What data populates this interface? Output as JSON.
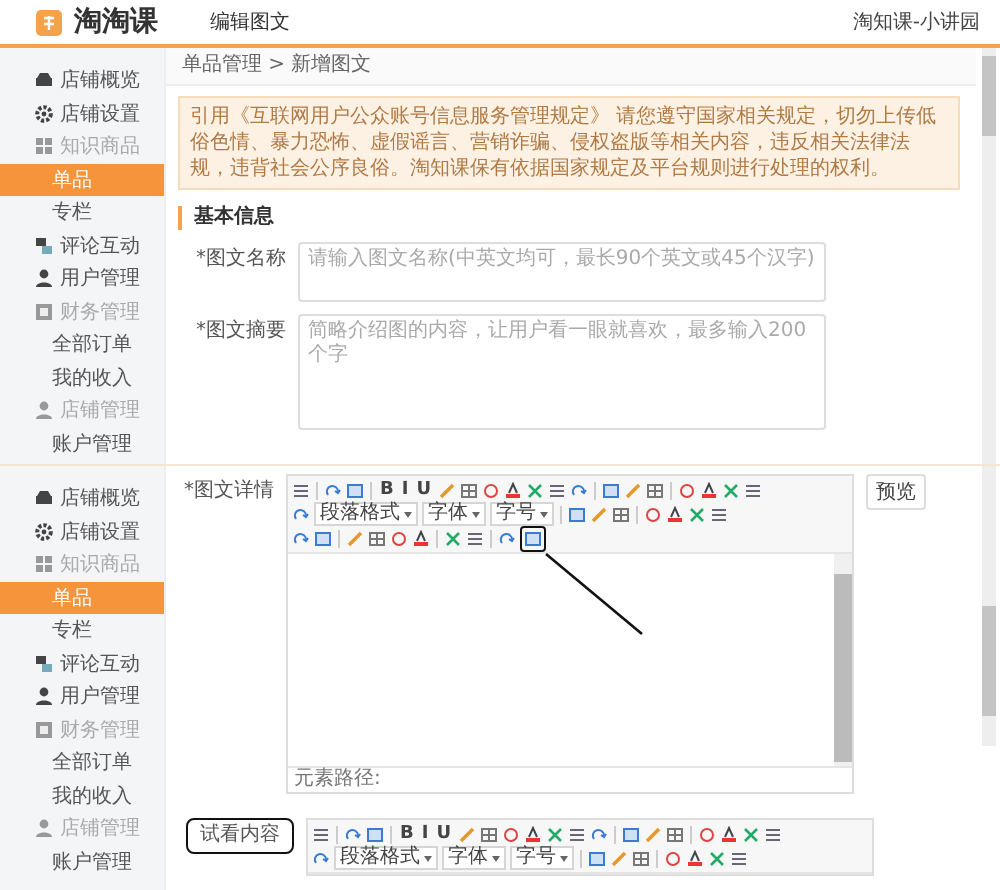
{
  "screens": [
    {
      "kind": "form_top",
      "header": {
        "logo": "淘淘课",
        "tab": "编辑图文",
        "account": "淘知课-小讲园"
      },
      "sidebar": {
        "items": [
          {
            "label": "店铺概览",
            "selected": false
          },
          {
            "label": "店铺设置",
            "selected": false
          },
          {
            "label": "知识商品",
            "selected": false,
            "expanded": true,
            "children": [
              {
                "label": "单品",
                "selected": true
              },
              {
                "label": "专栏",
                "selected": false
              }
            ]
          },
          {
            "label": "评论互动",
            "selected": false
          },
          {
            "label": "用户管理",
            "selected": false
          },
          {
            "label": "财务管理",
            "selected": false,
            "expanded": true,
            "children": [
              {
                "label": "全部订单",
                "selected": false
              },
              {
                "label": "我的收入",
                "selected": false
              }
            ]
          },
          {
            "label": "店铺管理",
            "selected": false,
            "expanded": true,
            "children": [
              {
                "label": "账户管理",
                "selected": false
              }
            ]
          }
        ]
      },
      "breadcrumb": "单品管理 > 新增图文",
      "notice": "引用《互联网用户公众账号信息服务管理规定》 请您遵守国家相关规定，切勿上传低俗色情、暴力恐怖、虚假谣言、营销诈骗、侵权盗版等相关内容，违反相关法律法规，违背社会公序良俗。淘知课保有依据国家规定及平台规则进行处理的权利。",
      "section_title": "基本信息",
      "fields": [
        {
          "label": "*图文名称",
          "kind": "input",
          "placeholder": "请输入图文名称(中英文均可，最长90个英文或45个汉字)"
        },
        {
          "label": "*图文摘要",
          "kind": "textarea",
          "placeholder": "简略介绍图的内容，让用户看一眼就喜欢，最多输入200个字"
        }
      ]
    },
    {
      "kind": "form_bottom",
      "sidebar": {
        "items": [
          {
            "label": "店铺概览",
            "selected": false
          },
          {
            "label": "店铺设置",
            "selected": false
          },
          {
            "label": "知识商品",
            "selected": false,
            "expanded": true,
            "children": [
              {
                "label": "单品",
                "selected": true
              },
              {
                "label": "专栏",
                "selected": false
              }
            ]
          },
          {
            "label": "评论互动",
            "selected": false
          },
          {
            "label": "用户管理",
            "selected": false
          },
          {
            "label": "财务管理",
            "selected": false,
            "expanded": true,
            "children": [
              {
                "label": "全部订单",
                "selected": false
              },
              {
                "label": "我的收入",
                "selected": false
              }
            ]
          },
          {
            "label": "店铺管理",
            "selected": false,
            "expanded": true,
            "children": [
              {
                "label": "账户管理",
                "selected": false
              }
            ]
          }
        ]
      },
      "editors": [
        {
          "label": "*图文详情",
          "circled": false,
          "preview_button": "预览",
          "status": "元素路径:",
          "toolbar": [
            [
              {
                "kind": "tool"
              },
              {
                "kind": "sep"
              },
              {
                "kind": "tool"
              },
              {
                "kind": "tool"
              },
              {
                "kind": "sep"
              },
              {
                "kind": "text",
                "text": "B"
              },
              {
                "kind": "text",
                "text": "I"
              },
              {
                "kind": "text",
                "text": "U"
              },
              {
                "kind": "tool"
              },
              {
                "kind": "tool"
              },
              {
                "kind": "tool"
              },
              {
                "kind": "tool"
              },
              {
                "kind": "tool"
              },
              {
                "kind": "tool"
              },
              {
                "kind": "tool"
              },
              {
                "kind": "sep"
              },
              {
                "kind": "tool"
              },
              {
                "kind": "tool"
              },
              {
                "kind": "tool"
              },
              {
                "kind": "sep"
              },
              {
                "kind": "tool"
              },
              {
                "kind": "tool"
              },
              {
                "kind": "tool"
              },
              {
                "kind": "tool"
              }
            ],
            [
              {
                "kind": "tool"
              },
              {
                "kind": "select",
                "text": "段落格式"
              },
              {
                "kind": "select",
                "text": "字体"
              },
              {
                "kind": "select",
                "text": "字号"
              },
              {
                "kind": "sep"
              },
              {
                "kind": "tool"
              },
              {
                "kind": "tool"
              },
              {
                "kind": "tool"
              },
              {
                "kind": "sep"
              },
              {
                "kind": "tool"
              },
              {
                "kind": "tool"
              },
              {
                "kind": "tool"
              },
              {
                "kind": "tool"
              }
            ],
            [
              {
                "kind": "tool"
              },
              {
                "kind": "tool"
              },
              {
                "kind": "sep"
              },
              {
                "kind": "tool"
              },
              {
                "kind": "tool"
              },
              {
                "kind": "tool"
              },
              {
                "kind": "tool"
              },
              {
                "kind": "sep"
              },
              {
                "kind": "tool"
              },
              {
                "kind": "tool"
              },
              {
                "kind": "sep"
              },
              {
                "kind": "tool"
              },
              {
                "kind": "tool",
                "circled": true
              }
            ]
          ]
        },
        {
          "label": "试看内容",
          "circled": true,
          "toolbar": [
            [
              {
                "kind": "tool"
              },
              {
                "kind": "sep"
              },
              {
                "kind": "tool"
              },
              {
                "kind": "tool"
              },
              {
                "kind": "sep"
              },
              {
                "kind": "text",
                "text": "B"
              },
              {
                "kind": "text",
                "text": "I"
              },
              {
                "kind": "text",
                "text": "U"
              },
              {
                "kind": "tool"
              },
              {
                "kind": "tool"
              },
              {
                "kind": "tool"
              },
              {
                "kind": "tool"
              },
              {
                "kind": "tool"
              },
              {
                "kind": "tool"
              },
              {
                "kind": "tool"
              },
              {
                "kind": "sep"
              },
              {
                "kind": "tool"
              },
              {
                "kind": "tool"
              },
              {
                "kind": "tool"
              },
              {
                "kind": "sep"
              },
              {
                "kind": "tool"
              },
              {
                "kind": "tool"
              },
              {
                "kind": "tool"
              },
              {
                "kind": "tool"
              }
            ],
            [
              {
                "kind": "tool"
              },
              {
                "kind": "select",
                "text": "段落格式"
              },
              {
                "kind": "select",
                "text": "字体"
              },
              {
                "kind": "select",
                "text": "字号"
              },
              {
                "kind": "sep"
              },
              {
                "kind": "tool"
              },
              {
                "kind": "tool"
              },
              {
                "kind": "tool"
              },
              {
                "kind": "sep"
              },
              {
                "kind": "tool"
              },
              {
                "kind": "tool"
              },
              {
                "kind": "tool"
              },
              {
                "kind": "tool"
              }
            ]
          ]
        }
      ]
    }
  ]
}
